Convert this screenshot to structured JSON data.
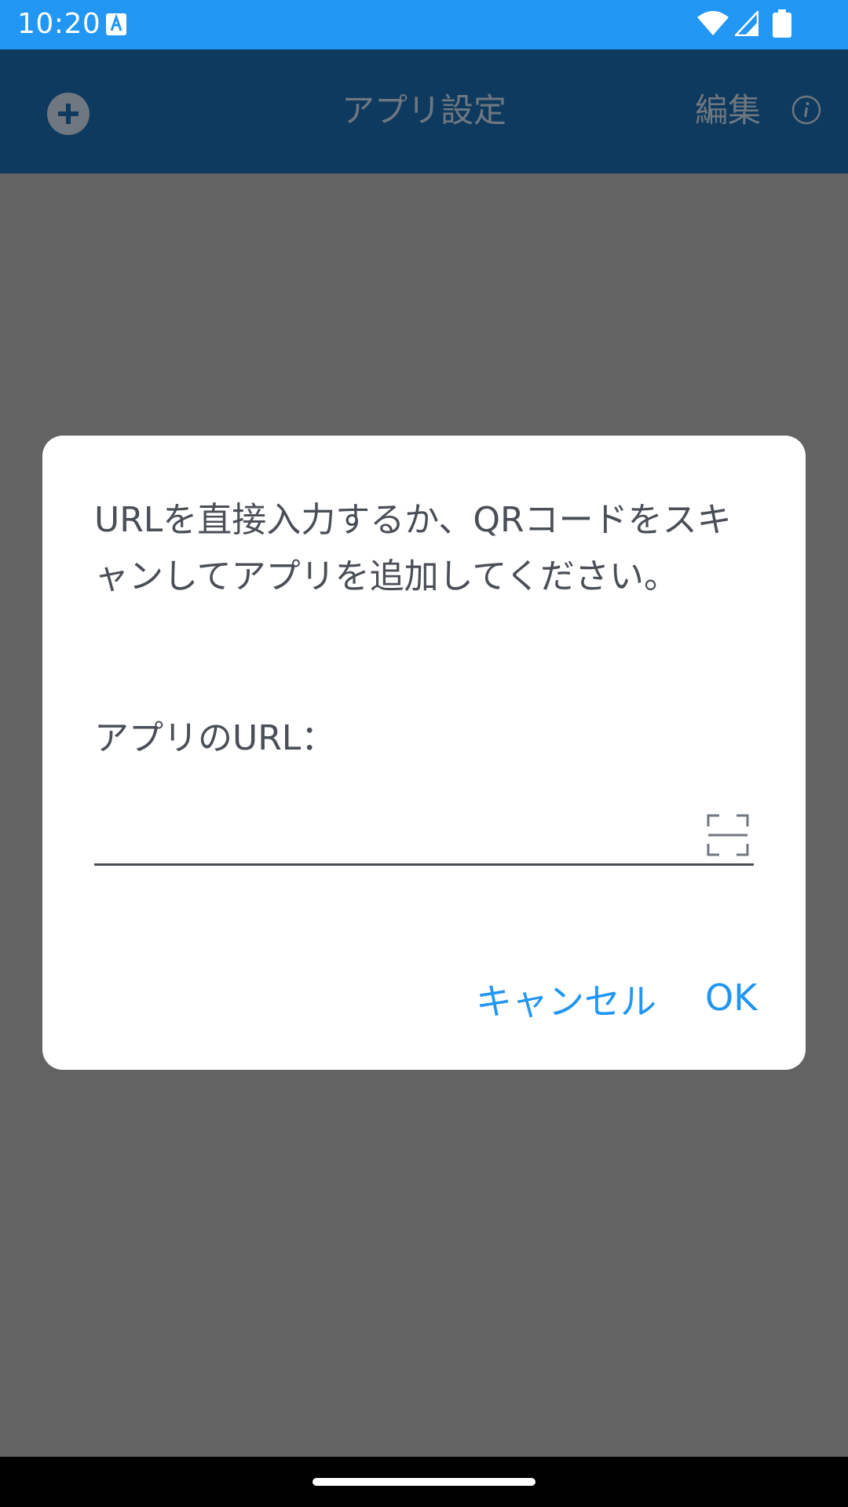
{
  "status_bar": {
    "time": "10:20",
    "icons": [
      "text-a-icon",
      "wifi-icon",
      "signal-icon",
      "battery-icon"
    ]
  },
  "app_bar": {
    "title": "アプリ設定",
    "edit_label": "編集",
    "icons": [
      "add-icon",
      "info-icon"
    ]
  },
  "dialog": {
    "message": "URLを直接入力するか、QRコードをスキャンしてアプリを追加してください。",
    "url_label": "アプリのURL：",
    "url_value": "",
    "cancel_label": "キャンセル",
    "ok_label": "OK"
  },
  "colors": {
    "status_bar": "#2196F3",
    "app_bar": "#0E3A5F",
    "scrim": "#636363",
    "accent": "#2196F3"
  }
}
